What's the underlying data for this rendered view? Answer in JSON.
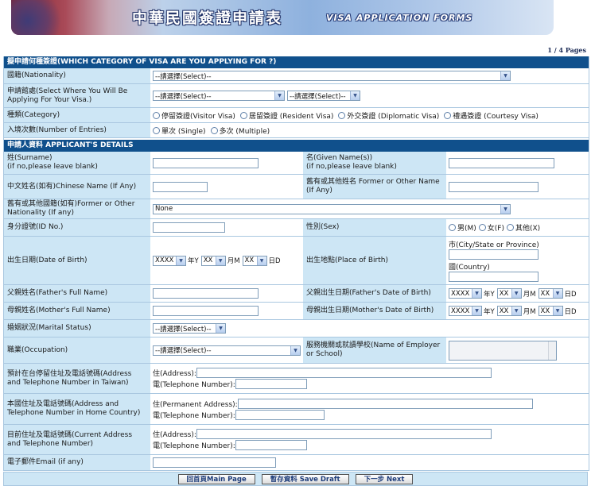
{
  "header": {
    "title_cn": "中華民國簽證申請表",
    "title_en": "VISA APPLICATION FORMS",
    "page_indicator": "1 / 4 Pages"
  },
  "section_visa": {
    "title": "擬申請何種簽證(WHICH CATEGORY OF VISA ARE YOU APPLYING FOR ?)",
    "nationality": {
      "label": "國籍(Nationality)",
      "value": "--請選擇(Select)--"
    },
    "apply_where": {
      "label": "申請館處(Select Where You Will Be Applying For Your Visa.)",
      "value1": "--請選擇(Select)--",
      "value2": "--請選擇(Select)--"
    },
    "category": {
      "label": "種類(Category)",
      "options": [
        "停留簽證(Visitor Visa)",
        "居留簽證 (Resident Visa)",
        "外交簽證 (Diplomatic Visa)",
        "禮遇簽證 (Courtesy Visa)"
      ]
    },
    "entries": {
      "label": "入境次數(Number of Entries)",
      "options": [
        "單次 (Single)",
        "多次 (Multiple)"
      ]
    }
  },
  "section_applicant": {
    "title": "申請人資料 APPLICANT'S DETAILS",
    "surname": {
      "label1": "姓(Surname)",
      "label2": "(if no,please leave blank)"
    },
    "given_name": {
      "label1": "名(Given Name(s))",
      "label2": "(if no,please leave blank)"
    },
    "chinese_name": {
      "label": "中文姓名(如有)Chinese Name (If Any)"
    },
    "former_name": {
      "label": "舊有或其他姓名 Former or Other Name (If Any)"
    },
    "former_nationality": {
      "label": "舊有或其他國籍(如有)Former or Other Nationality (If any)",
      "value": "None"
    },
    "id_no": {
      "label": "身分證號(ID No.)"
    },
    "sex": {
      "label": "性別(Sex)",
      "options": [
        "男(M)",
        "女(F)",
        "其他(X)"
      ]
    },
    "dob": {
      "label": "出生日期(Date of Birth)",
      "year": "XXXX",
      "month": "XX",
      "day": "XX",
      "u_year": "年Y",
      "u_month": "月M",
      "u_day": "日D"
    },
    "pob": {
      "label": "出生地點(Place of Birth)",
      "city_label": "市(City/State or Province)",
      "country_label": "國(Country)"
    },
    "father_name": {
      "label": "父親姓名(Father's Full Name)"
    },
    "father_dob": {
      "label": "父親出生日期(Father's Date of Birth)",
      "year": "XXXX",
      "month": "XX",
      "day": "XX"
    },
    "mother_name": {
      "label": "母親姓名(Mother's Full Name)"
    },
    "mother_dob": {
      "label": "母親出生日期(Mother's Date of Birth)",
      "year": "XXXX",
      "month": "XX",
      "day": "XX"
    },
    "marital": {
      "label": "婚姻狀況(Marital Status)",
      "value": "--請選擇(Select)--"
    },
    "occupation": {
      "label": "職業(Occupation)",
      "value": "--請選擇(Select)--"
    },
    "employer": {
      "label": "服務機關或就讀學校(Name of Employer or School)"
    },
    "taiwan_address": {
      "label": "預計在台停留住址及電話號碼(Address and Telephone Number in Taiwan)",
      "addr_label": "住(Address):",
      "tel_label": "電(Telephone Number):"
    },
    "home_address": {
      "label": "本國住址及電話號碼(Address and Telephone Number in Home Country)",
      "addr_label": "住(Permanent Address):",
      "tel_label": "電(Telephone Number):"
    },
    "current_address": {
      "label": "目前住址及電話號碼(Current Address and Telephone Number)",
      "addr_label": "住(Address):",
      "tel_label": "電(Telephone Number):"
    },
    "email": {
      "label": "電子郵件Email (if any)"
    }
  },
  "buttons": {
    "main_page": "回首頁Main Page",
    "save_draft": "暫存資料 Save Draft",
    "next": "下一步 Next"
  }
}
